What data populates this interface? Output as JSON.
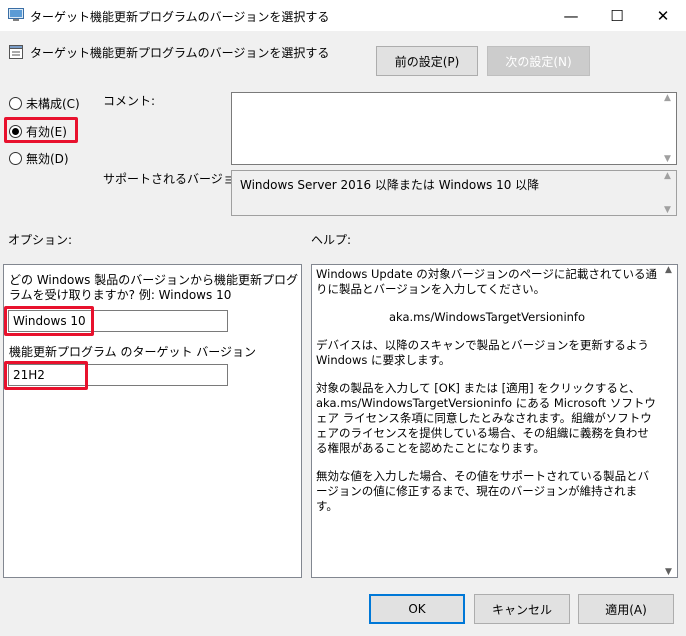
{
  "window": {
    "title": "ターゲット機能更新プログラムのバージョンを選択する",
    "controls": {
      "minimize": "—",
      "maximize": "☐",
      "close": "✕"
    }
  },
  "header": {
    "title": "ターゲット機能更新プログラムのバージョンを選択する",
    "prev_button": "前の設定(P)",
    "next_button": "次の設定(N)"
  },
  "state": {
    "options": [
      {
        "label": "未構成(C)",
        "selected": false
      },
      {
        "label": "有効(E)",
        "selected": true
      },
      {
        "label": "無効(D)",
        "selected": false
      }
    ]
  },
  "comment": {
    "label": "コメント:",
    "value": ""
  },
  "supported": {
    "label": "サポートされるバージョン:",
    "value": "Windows Server 2016 以降または Windows 10 以降"
  },
  "options_section": {
    "label": "オプション:",
    "product_label": "どの Windows 製品のバージョンから機能更新プログラムを受け取りますか? 例: Windows 10",
    "product_value": "Windows 10",
    "target_label": "機能更新プログラム のターゲット バージョン",
    "target_value": "21H2"
  },
  "help": {
    "label": "ヘルプ:",
    "paragraphs": [
      "Windows Update の対象バージョンのページに記載されている通りに製品とバージョンを入力してください。",
      "aka.ms/WindowsTargetVersioninfo",
      "デバイスは、以降のスキャンで製品とバージョンを更新するよう Windows に要求します。",
      "対象の製品を入力して [OK] または [適用] をクリックすると、aka.ms/WindowsTargetVersioninfo にある Microsoft ソフトウェア ライセンス条項に同意したとみなされます。組織がソフトウェアのライセンスを提供している場合、その組織に義務を負わせる権限があることを認めたことになります。",
      "無効な値を入力した場合、その値をサポートされている製品とバージョンの値に修正するまで、現在のバージョンが維持されます。"
    ]
  },
  "footer": {
    "ok": "OK",
    "cancel": "キャンセル",
    "apply": "適用(A)"
  },
  "colors": {
    "highlight": "#e8112d",
    "accent": "#0078d7",
    "dialog_bg": "#f0f0f0"
  }
}
